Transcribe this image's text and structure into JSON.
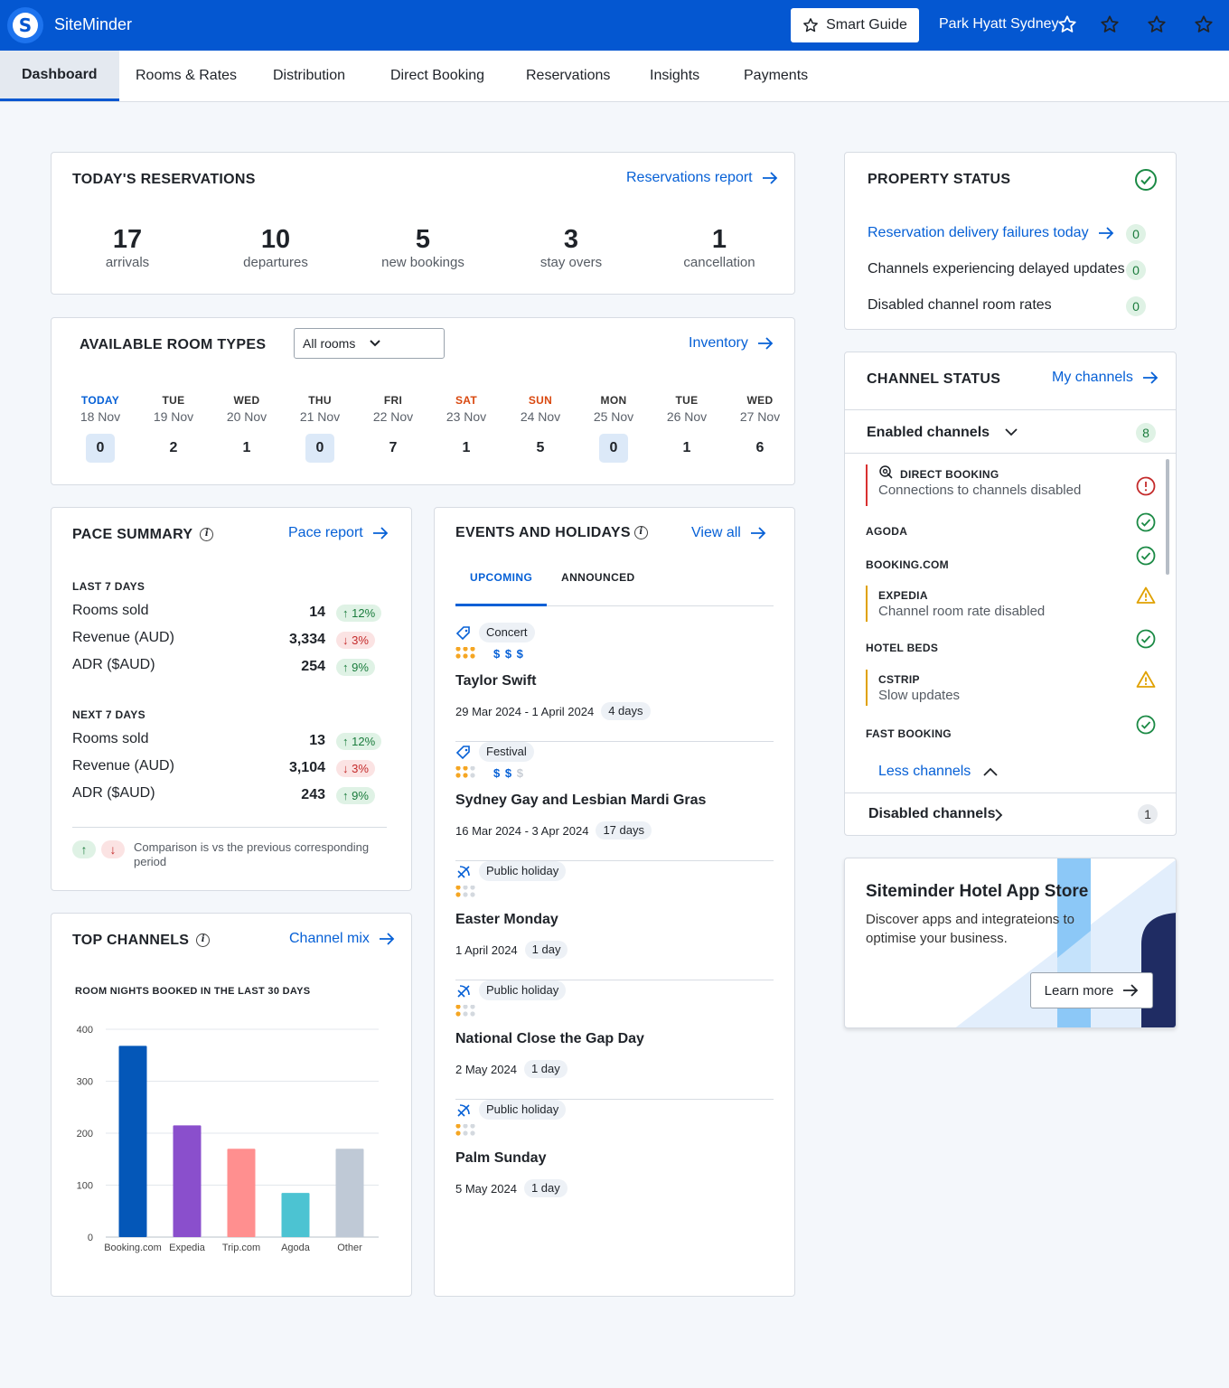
{
  "header": {
    "brand": "SiteMinder",
    "smart_guide": "Smart Guide",
    "property_name": "Park Hyatt Sydney",
    "brand_color": "#0457d1"
  },
  "nav": {
    "tabs": [
      {
        "label": "Dashboard",
        "active": true
      },
      {
        "label": "Rooms & Rates"
      },
      {
        "label": "Distribution"
      },
      {
        "label": "Direct Booking"
      },
      {
        "label": "Reservations"
      },
      {
        "label": "Insights"
      },
      {
        "label": "Payments"
      }
    ]
  },
  "reservations": {
    "title": "TODAY'S RESERVATIONS",
    "link": "Reservations report",
    "stats": [
      {
        "value": "17",
        "label": "arrivals"
      },
      {
        "value": "10",
        "label": "departures"
      },
      {
        "value": "5",
        "label": "new bookings"
      },
      {
        "value": "3",
        "label": "stay overs"
      },
      {
        "value": "1",
        "label": "cancellation"
      }
    ]
  },
  "room_types": {
    "title": "AVAILABLE ROOM TYPES",
    "filter": "All rooms",
    "link": "Inventory",
    "days": [
      {
        "dow": "TODAY",
        "date": "18 Nov",
        "value": "0"
      },
      {
        "dow": "TUE",
        "date": "19 Nov",
        "value": "2"
      },
      {
        "dow": "WED",
        "date": "20 Nov",
        "value": "1"
      },
      {
        "dow": "THU",
        "date": "21 Nov",
        "value": "0"
      },
      {
        "dow": "FRI",
        "date": "22 Nov",
        "value": "7"
      },
      {
        "dow": "SAT",
        "date": "23 Nov",
        "value": "1"
      },
      {
        "dow": "SUN",
        "date": "24 Nov",
        "value": "5"
      },
      {
        "dow": "MON",
        "date": "25 Nov",
        "value": "0"
      },
      {
        "dow": "TUE",
        "date": "26 Nov",
        "value": "1"
      },
      {
        "dow": "WED",
        "date": "27 Nov",
        "value": "6"
      }
    ]
  },
  "pace": {
    "title": "PACE SUMMARY",
    "link": "Pace report",
    "last7": {
      "heading": "LAST 7 DAYS",
      "rows": [
        {
          "label": "Rooms sold",
          "value": "14",
          "change": "12%",
          "dir": "up"
        },
        {
          "label": "Revenue (AUD)",
          "value": "3,334",
          "change": "3%",
          "dir": "down"
        },
        {
          "label": "ADR ($AUD)",
          "value": "254",
          "change": "9%",
          "dir": "up"
        }
      ]
    },
    "next7": {
      "heading": "NEXT 7 DAYS",
      "rows": [
        {
          "label": "Rooms sold",
          "value": "13",
          "change": "12%",
          "dir": "up"
        },
        {
          "label": "Revenue (AUD)",
          "value": "3,104",
          "change": "3%",
          "dir": "down"
        },
        {
          "label": "ADR ($AUD)",
          "value": "243",
          "change": "9%",
          "dir": "up"
        }
      ]
    },
    "note": "Comparison is vs the previous corresponding period"
  },
  "top_channels": {
    "title": "TOP CHANNELS",
    "link": "Channel mix"
  },
  "chart_data": {
    "type": "bar",
    "title": "ROOM NIGHTS BOOKED IN THE LAST 30 DAYS",
    "categories": [
      "Booking.com",
      "Expedia",
      "Trip.com",
      "Agoda",
      "Other"
    ],
    "values": [
      368,
      215,
      170,
      85,
      170
    ],
    "colors": [
      "#0457b8",
      "#8a4fcc",
      "#ff8f8f",
      "#4cc3d2",
      "#bfc9d6"
    ],
    "ylim": [
      0,
      400
    ],
    "yticks": [
      0,
      100,
      200,
      300,
      400
    ],
    "grid": true
  },
  "events": {
    "title": "EVENTS AND HOLIDAYS",
    "link": "View all",
    "tabs": [
      "UPCOMING",
      "ANNOUNCED"
    ],
    "items": [
      {
        "tag": "Concert",
        "icon": "ticket-icon",
        "impact": 3,
        "price": "$$$",
        "price_level": 3,
        "name": "Taylor Swift",
        "dates": "29 Mar 2024 - 1 April 2024",
        "duration": "4 days"
      },
      {
        "tag": "Festival",
        "icon": "ticket-icon",
        "impact": 2,
        "price": "$$$",
        "price_level": 2,
        "name": "Sydney Gay and Lesbian Mardi Gras",
        "dates": "16 Mar 2024 - 3 Apr 2024",
        "duration": "17 days"
      },
      {
        "tag": "Public holiday",
        "icon": "holiday-icon",
        "impact": 1,
        "price": "",
        "price_level": 0,
        "name": "Easter Monday",
        "dates": "1 April 2024",
        "duration": "1 day"
      },
      {
        "tag": "Public holiday",
        "icon": "holiday-icon",
        "impact": 1,
        "price": "",
        "price_level": 0,
        "name": "National Close the Gap Day",
        "dates": "2 May 2024",
        "duration": "1 day"
      },
      {
        "tag": "Public holiday",
        "icon": "holiday-icon",
        "impact": 1,
        "price": "",
        "price_level": 0,
        "name": "Palm Sunday",
        "dates": "5 May 2024",
        "duration": "1 day"
      }
    ]
  },
  "property_status": {
    "title": "PROPERTY STATUS",
    "rows": [
      {
        "label": "Reservation delivery failures today",
        "count": "0",
        "link": true
      },
      {
        "label": "Channels experiencing delayed updates",
        "count": "0"
      },
      {
        "label": "Disabled channel room rates",
        "count": "0"
      }
    ]
  },
  "channel_status": {
    "title": "CHANNEL STATUS",
    "link": "My channels",
    "enabled_label": "Enabled channels",
    "enabled_count": "8",
    "channels": [
      {
        "name": "DIRECT BOOKING",
        "sub": "Connections to channels disabled",
        "status": "error"
      },
      {
        "name": "AGODA",
        "sub": "",
        "status": "ok"
      },
      {
        "name": "BOOKING.COM",
        "sub": "",
        "status": "ok"
      },
      {
        "name": "EXPEDIA",
        "sub": "Channel room rate disabled",
        "status": "warning"
      },
      {
        "name": "HOTEL BEDS",
        "sub": "",
        "status": "ok"
      },
      {
        "name": "CSTRIP",
        "sub": "Slow updates",
        "status": "warning"
      },
      {
        "name": "FAST BOOKING",
        "sub": "",
        "status": "ok"
      }
    ],
    "less_label": "Less channels",
    "disabled_label": "Disabled channels",
    "disabled_count": "1"
  },
  "app_store": {
    "title": "Siteminder Hotel App Store",
    "description": "Discover apps and integrateions to optimise your business.",
    "button": "Learn more"
  }
}
